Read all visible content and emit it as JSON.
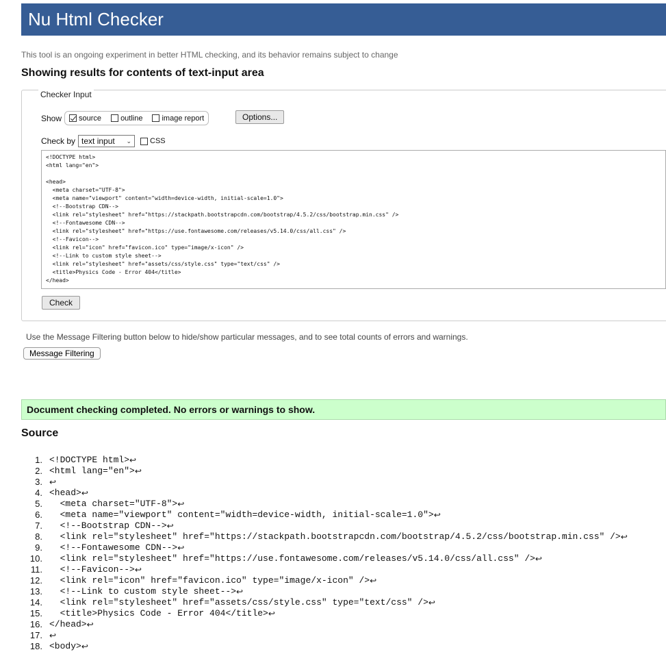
{
  "header": {
    "title": "Nu Html Checker"
  },
  "tagline": "This tool is an ongoing experiment in better HTML checking, and its behavior remains subject to change",
  "showing_results": "Showing results for contents of text-input area",
  "checker_input": {
    "legend": "Checker Input",
    "show_label": "Show",
    "options": [
      {
        "label": "source",
        "checked": true
      },
      {
        "label": "outline",
        "checked": false
      },
      {
        "label": "image report",
        "checked": false
      }
    ],
    "options_button": "Options...",
    "check_by_label": "Check by",
    "check_by_value": "text input",
    "css_label": "CSS",
    "textarea_value": "<!DOCTYPE html>\n<html lang=\"en\">\n\n<head>\n  <meta charset=\"UTF-8\">\n  <meta name=\"viewport\" content=\"width=device-width, initial-scale=1.0\">\n  <!--Bootstrap CDN-->\n  <link rel=\"stylesheet\" href=\"https://stackpath.bootstrapcdn.com/bootstrap/4.5.2/css/bootstrap.min.css\" />\n  <!--Fontawesome CDN-->\n  <link rel=\"stylesheet\" href=\"https://use.fontawesome.com/releases/v5.14.0/css/all.css\" />\n  <!--Favicon-->\n  <link rel=\"icon\" href=\"favicon.ico\" type=\"image/x-icon\" />\n  <!--Link to custom style sheet-->\n  <link rel=\"stylesheet\" href=\"assets/css/style.css\" type=\"text/css\" />\n  <title>Physics Code - Error 404</title>\n</head>",
    "check_button": "Check"
  },
  "message_filtering": {
    "text": "Use the Message Filtering button below to hide/show particular messages, and to see total counts of errors and warnings.",
    "button": "Message Filtering"
  },
  "result_message": "Document checking completed. No errors or warnings to show.",
  "source": {
    "title": "Source",
    "lines": [
      {
        "n": "1.",
        "code": "<!DOCTYPE html>"
      },
      {
        "n": "2.",
        "code": "<html lang=\"en\">"
      },
      {
        "n": "3.",
        "code": ""
      },
      {
        "n": "4.",
        "code": "<head>"
      },
      {
        "n": "5.",
        "code": "  <meta charset=\"UTF-8\">"
      },
      {
        "n": "6.",
        "code": "  <meta name=\"viewport\" content=\"width=device-width, initial-scale=1.0\">"
      },
      {
        "n": "7.",
        "code": "  <!--Bootstrap CDN-->"
      },
      {
        "n": "8.",
        "code": "  <link rel=\"stylesheet\" href=\"https://stackpath.bootstrapcdn.com/bootstrap/4.5.2/css/bootstrap.min.css\" />"
      },
      {
        "n": "9.",
        "code": "  <!--Fontawesome CDN-->"
      },
      {
        "n": "10.",
        "code": "  <link rel=\"stylesheet\" href=\"https://use.fontawesome.com/releases/v5.14.0/css/all.css\" />"
      },
      {
        "n": "11.",
        "code": "  <!--Favicon-->"
      },
      {
        "n": "12.",
        "code": "  <link rel=\"icon\" href=\"favicon.ico\" type=\"image/x-icon\" />"
      },
      {
        "n": "13.",
        "code": "  <!--Link to custom style sheet-->"
      },
      {
        "n": "14.",
        "code": "  <link rel=\"stylesheet\" href=\"assets/css/style.css\" type=\"text/css\" />"
      },
      {
        "n": "15.",
        "code": "  <title>Physics Code - Error 404</title>"
      },
      {
        "n": "16.",
        "code": "</head>"
      },
      {
        "n": "17.",
        "code": ""
      },
      {
        "n": "18.",
        "code": "<body>"
      }
    ],
    "line_end_glyph": "↩"
  },
  "colors": {
    "header_bg": "#365d95",
    "success_bg": "#ccffcc"
  }
}
